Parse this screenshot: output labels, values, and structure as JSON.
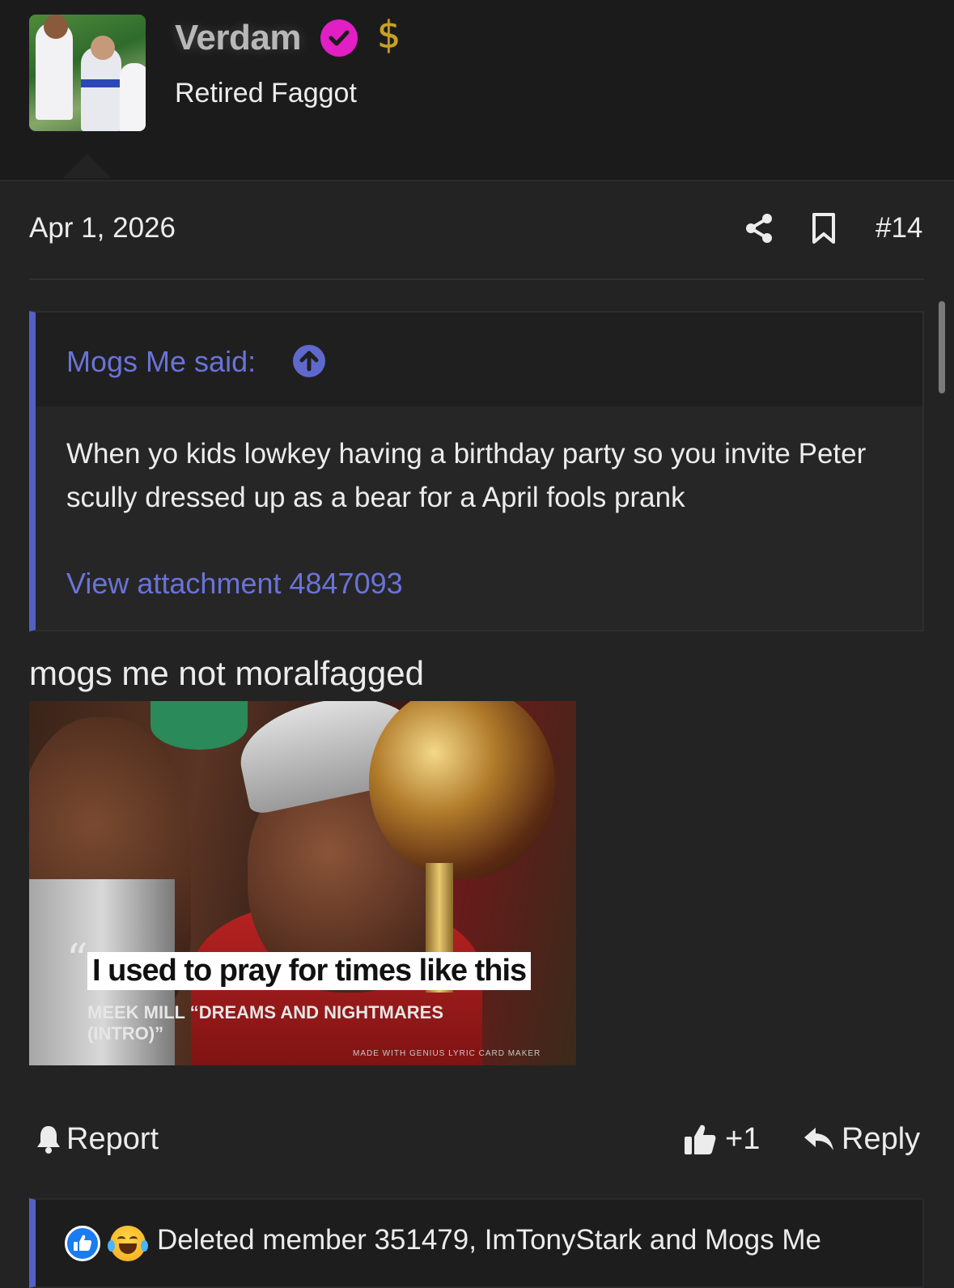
{
  "user": {
    "name": "Verdam",
    "title": "Retired Faggot"
  },
  "post": {
    "date": "Apr 1, 2026",
    "number": "#14",
    "reply_text": "mogs me not moralfagged"
  },
  "quote": {
    "author": "Mogs Me said:",
    "text": "When yo kids lowkey having a birthday party so you invite Peter scully dressed up as a bear for a April fools prank",
    "attachment_link": "View attachment 4847093"
  },
  "meme": {
    "quote_mark": "“",
    "caption": "I used to pray for times like this",
    "credit": "MEEK MILL “DREAMS AND NIGHTMARES (INTRO)”",
    "watermark": "MADE WITH GENIUS LYRIC CARD MAKER"
  },
  "actions": {
    "report": "Report",
    "like_count": "+1",
    "reply": "Reply"
  },
  "reactions": {
    "text": "Deleted member 351479, ImTonyStark and Mogs Me"
  },
  "icons": {
    "verified": "verified-check-icon",
    "dollar": "dollar-icon",
    "share": "share-icon",
    "bookmark": "bookmark-icon",
    "quote_arrow": "arrow-up-circle-icon",
    "bell": "bell-icon",
    "thumb": "thumbs-up-icon",
    "reply": "reply-arrow-icon",
    "reaction_like": "like-reaction-icon",
    "reaction_laugh": "laugh-reaction-icon"
  },
  "colors": {
    "background": "#1b1b1c",
    "post_background": "#232324",
    "accent": "#5560c4",
    "link": "#6a73d6",
    "verified": "#e21ec5",
    "dollar": "#c9a022"
  }
}
